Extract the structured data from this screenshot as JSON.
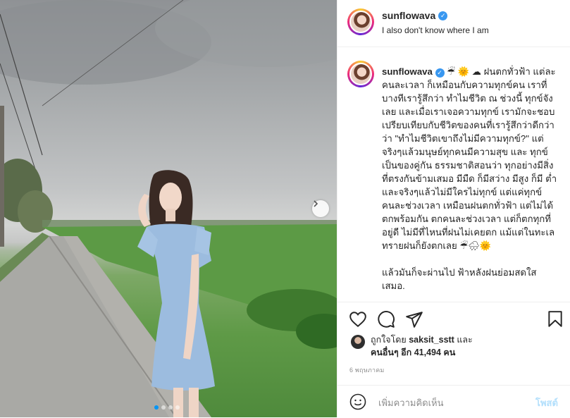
{
  "post": {
    "username": "sunflowava",
    "location": "I also don't know where I am",
    "verified_icon": "verified-badge-icon",
    "caption_user": "sunflowava",
    "caption_emojis": "☔ 🌞 ☁",
    "caption_text": "ฝนตกทั่วฟ้า แต่ละคนละเวลา ก็เหมือนกับความทุกข์คน เราที่บางทีเรารู้สึกว่า ทำไมชีวิต ณ ช่วงนี้ ทุกข์จังเลย และเมื่อเราเจอความทุกข์ เรามักจะชอบเปรียบเทียบกับชีวิตของคนที่เรารู้สึกว่าดีกว่า ว่า \"ทำไมชีวิตเขาถึงไม่มีความทุกข์?\" แต่จริงๆแล้วมนุษย์ทุกคนมีความสุข และ ทุกข์ เป็นของคู่กัน ธรรมชาติสอนว่า ทุกอย่างมีสิ่งที่ตรงกันข้ามเสมอ มีมืด ก็มีสว่าง มีสูง ก็มี ต่ำ และจริงๆแล้วไม่มีใครไม่ทุกข์ แต่แค่ทุกข์คนละช่วงเวลา เหมือนฝนตกทั่วฟ้า แต่ไม่ได้ตกพร้อมกัน ตกคนละช่วงเวลา แต่ก็ตกทุกที่อยู่ดี ไม่มีที่ไหนที่ฝนไม่เคยตก แม้แต่ในทะเลทรายฝนก็ยังตกเลย ☔🌧🌞",
    "caption_text_2": "แล้วมันก็จะผ่านไป ฟ้าหลังฝนย่อมสดใสเสมอ.",
    "liked_by_prefix": "ถูกใจโดย",
    "liked_by_user": "saksit_sstt",
    "liked_by_and": "และ",
    "liked_by_others": "คนอื่นๆ อีก 41,494 คน",
    "date": "6 พฤษภาคม",
    "comment_placeholder": "เพิ่มความคิดเห็น",
    "post_button": "โพสต์",
    "carousel_count": 4,
    "carousel_active": 1,
    "accent_color": "#0095f6",
    "post_button_color": "#b2dffc",
    "icons": [
      "heart-icon",
      "comment-icon",
      "share-icon",
      "bookmark-icon",
      "emoji-icon",
      "chevron-right-icon"
    ]
  }
}
